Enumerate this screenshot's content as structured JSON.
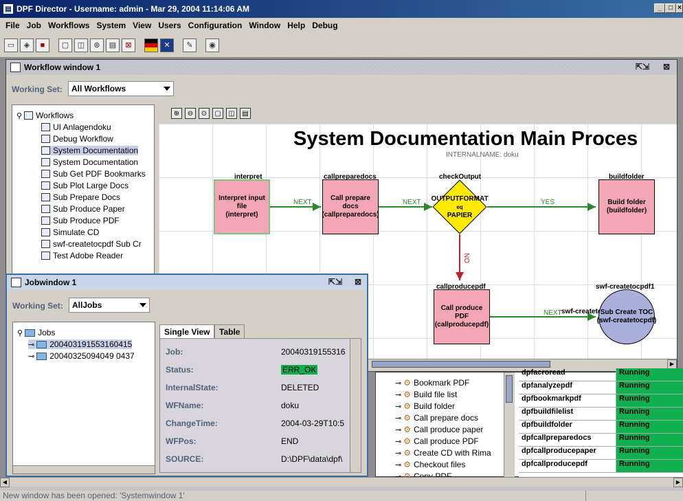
{
  "app": {
    "title": "DPF Director - Username: admin - Mar 29, 2004 11:14:06 AM",
    "icon": "dpf-app-icon"
  },
  "menu": [
    "File",
    "Job",
    "Workflows",
    "System",
    "View",
    "Users",
    "Configuration",
    "Window",
    "Help",
    "Debug"
  ],
  "toolbar_icons": [
    "new-icon",
    "open-icon",
    "save-icon",
    "window1-icon",
    "window2-icon",
    "window3-icon",
    "window4-icon",
    "close-window-icon",
    "german-flag-icon",
    "uk-flag-icon",
    "tools-icon",
    "eye-icon"
  ],
  "workflow_window": {
    "title": "Workflow window 1",
    "working_set_label": "Working Set:",
    "working_set_value": "All Workflows",
    "tree_root": "Workflows",
    "tree_items": [
      "UI Anlagendoku",
      "Debug Workflow",
      "System Documentation",
      "System Documentation",
      "Sub Get PDF Bookmarks",
      "Sub Plot Large Docs",
      "Sub Prepare Docs",
      "Sub Produce Paper",
      "Sub Produce PDF",
      "Simulate CD",
      "swf-createtocpdf Sub Cr",
      "Test Adobe Reader"
    ],
    "diagram_toolbar": [
      "zoom-in-icon",
      "zoom-out-icon",
      "zoom-reset-icon",
      "fit-icon",
      "layout-icon",
      "export-icon"
    ],
    "diagram": {
      "title": "System Documentation Main Proces",
      "subtitle": "INTERNALNAME: doku",
      "nodes": [
        {
          "id": "interpret",
          "text1": "Interpret input file",
          "text2": "(interpret)"
        },
        {
          "id": "callpreparedocs",
          "text1": "Call prepare docs",
          "text2": "(callpreparedocs)"
        },
        {
          "id": "checkOutput",
          "text1": "OUTPUTFORMAT",
          "text2": "eq",
          "text3": "PAPIER"
        },
        {
          "id": "buildfolder",
          "text1": "Build folder",
          "text2": "(buildfolder)"
        },
        {
          "id": "callproducepdf",
          "text1": "Call produce PDF",
          "text2": "(callproducepdf)"
        },
        {
          "id": "swf-createtocpdf1",
          "text1": "Sub Create TOC",
          "text2": "(swf-createtocpdf)"
        }
      ],
      "edges": [
        "NEXT",
        "NEXT",
        "YES",
        "NO",
        "NEXT",
        "swf-createtocpdf"
      ]
    }
  },
  "job_window": {
    "title": "Jobwindow 1",
    "working_set_label": "Working Set:",
    "working_set_value": "AllJobs",
    "tree_root": "Jobs",
    "jobs": [
      "200403191553160415",
      "20040325094049 0437"
    ],
    "tabs": [
      "Single View",
      "Table"
    ],
    "fields": [
      {
        "k": "Job:",
        "v": "20040319155316"
      },
      {
        "k": "Status:",
        "v": "ERR_OK"
      },
      {
        "k": "InternalState:",
        "v": "DELETED"
      },
      {
        "k": "WFName:",
        "v": "doku"
      },
      {
        "k": "ChangeTime:",
        "v": "2004-03-29T10:5"
      },
      {
        "k": "WFPos:",
        "v": "END"
      },
      {
        "k": "SOURCE:",
        "v": "D:\\DPF\\data\\dpf\\"
      }
    ]
  },
  "system_window": {
    "steps": [
      "Bookmark PDF",
      "Build file list",
      "Build folder",
      "Call prepare docs",
      "Call produce paper",
      "Call produce PDF",
      "Create CD with Rima",
      "Checkout files",
      "Copy PDF"
    ],
    "top_partial_step": "...",
    "services": [
      {
        "name": "dpfacroread",
        "status": "Running"
      },
      {
        "name": "dpfanalyzepdf",
        "status": "Running"
      },
      {
        "name": "dpfbookmarkpdf",
        "status": "Running"
      },
      {
        "name": "dpfbuildfilelist",
        "status": "Running"
      },
      {
        "name": "dpfbuildfolder",
        "status": "Running"
      },
      {
        "name": "dpfcallpreparedocs",
        "status": "Running"
      },
      {
        "name": "dpfcallproducepaper",
        "status": "Running"
      },
      {
        "name": "dpfcallproducepdf",
        "status": "Running"
      }
    ]
  },
  "status": "New window has been opened: 'Systemwindow 1'",
  "colors": {
    "title_bar": "#0a246a",
    "node_pink": "#f4a6b4",
    "decision_yellow": "#ffea00",
    "sub_circle": "#aab0dc",
    "edge_green": "#2a8a2a",
    "edge_red": "#c02020",
    "running_green": "#10b050",
    "label_blue": "#51617a",
    "status_ok_green": "#10b050"
  }
}
